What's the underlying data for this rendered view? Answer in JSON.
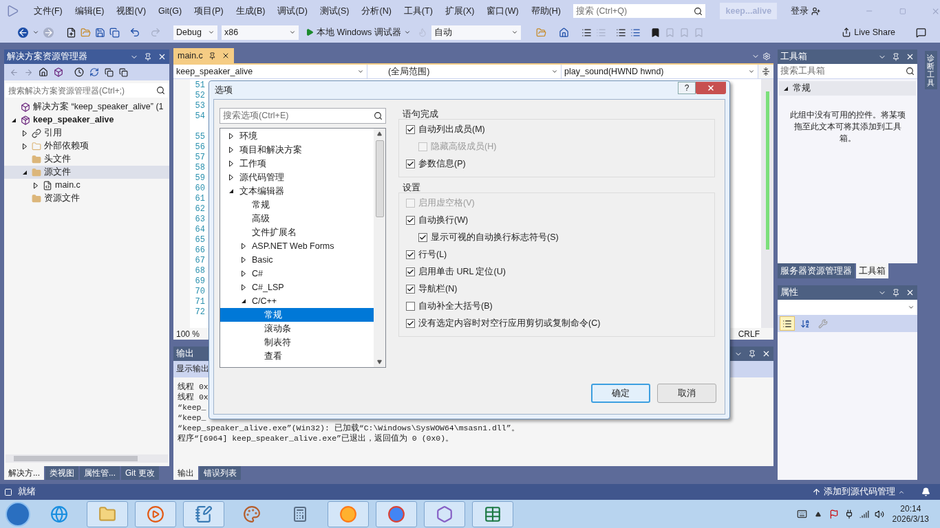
{
  "menu": {
    "items": [
      "文件(F)",
      "编辑(E)",
      "视图(V)",
      "Git(G)",
      "项目(P)",
      "生成(B)",
      "调试(D)",
      "测试(S)",
      "分析(N)",
      "工具(T)",
      "扩展(X)",
      "窗口(W)",
      "帮助(H)"
    ],
    "search_placeholder": "搜索 (Ctrl+Q)",
    "solution_badge": "keep...alive",
    "sign_in": "登录"
  },
  "toolbar": {
    "configuration": "Debug",
    "platform": "x86",
    "run_label": "本地 Windows 调试器",
    "target": "自动",
    "live_share": "Live Share"
  },
  "solution_explorer": {
    "title": "解决方案资源管理器",
    "search_placeholder": "搜索解决方案资源管理器(Ctrl+;)",
    "tree": [
      {
        "label": "解决方案 “keep_speaker_alive” (1",
        "kind": "solution",
        "selected": false
      },
      {
        "label": "keep_speaker_alive",
        "kind": "project",
        "expanded": true,
        "selected": false,
        "children": [
          {
            "label": "引用",
            "kind": "references",
            "expanded": false,
            "selected": false
          },
          {
            "label": "外部依赖项",
            "kind": "external",
            "expanded": false,
            "selected": false
          },
          {
            "label": "头文件",
            "kind": "filter",
            "selected": false
          },
          {
            "label": "源文件",
            "kind": "filter",
            "expanded": true,
            "selected": true,
            "children": [
              {
                "label": "main.c",
                "kind": "file",
                "expanded": false,
                "selected": false
              }
            ]
          },
          {
            "label": "资源文件",
            "kind": "filter",
            "selected": false
          }
        ]
      }
    ],
    "tabs": [
      {
        "label": "解决方...",
        "selected": true
      },
      {
        "label": "类视图",
        "selected": false
      },
      {
        "label": "属性管...",
        "selected": false
      },
      {
        "label": "Git 更改",
        "selected": false
      }
    ]
  },
  "editor": {
    "tabs": [
      {
        "label": "main.c",
        "selected": true
      }
    ],
    "nav": [
      "keep_speaker_alive",
      "(全局范围)",
      "play_sound(HWND hwnd)"
    ],
    "lines": [
      {
        "n": "51",
        "wrapped": false
      },
      {
        "n": "52",
        "wrapped": false
      },
      {
        "n": "53",
        "wrapped": false
      },
      {
        "n": "54",
        "wrapped": true
      },
      {
        "n": "55",
        "wrapped": false
      },
      {
        "n": "56",
        "wrapped": false
      },
      {
        "n": "57",
        "wrapped": false
      },
      {
        "n": "58",
        "wrapped": false
      },
      {
        "n": "59",
        "wrapped": false
      },
      {
        "n": "60",
        "wrapped": false
      },
      {
        "n": "61",
        "wrapped": false
      },
      {
        "n": "62",
        "wrapped": false
      },
      {
        "n": "63",
        "wrapped": false
      },
      {
        "n": "64",
        "wrapped": false
      },
      {
        "n": "65",
        "wrapped": false
      },
      {
        "n": "66",
        "wrapped": false
      },
      {
        "n": "67",
        "wrapped": false
      },
      {
        "n": "68",
        "wrapped": false
      },
      {
        "n": "69",
        "wrapped": false
      },
      {
        "n": "70",
        "wrapped": false
      },
      {
        "n": "71",
        "wrapped": false
      },
      {
        "n": "72",
        "wrapped": false
      }
    ],
    "zoom": "100 %",
    "line_ending": "CRLF"
  },
  "output": {
    "title": "输出",
    "source_label": "显示输出",
    "lines": [
      "线程 0x",
      "线程 0x",
      "“keep_",
      "“keep_",
      "“keep_speaker_alive.exe”(Win32): 已加载“C:\\Windows\\SysWOW64\\msasn1.dll”。",
      "程序“[6964] keep_speaker_alive.exe”已退出，返回值为 0 (0x0)。"
    ],
    "tabs": [
      {
        "label": "输出",
        "selected": true
      },
      {
        "label": "错误列表",
        "selected": false
      }
    ]
  },
  "toolbox": {
    "title": "工具箱",
    "search_placeholder": "搜索工具箱",
    "group": {
      "label": "常规",
      "expanded": true
    },
    "empty_message": "此组中没有可用的控件。将某项拖至此文本可将其添加到工具箱。",
    "tabs": [
      {
        "label": "服务器资源管理器",
        "selected": false
      },
      {
        "label": "工具箱",
        "selected": true
      }
    ]
  },
  "properties": {
    "title": "属性",
    "tools": [
      {
        "kind": "categorized",
        "selected": true
      },
      {
        "kind": "alphabetical",
        "selected": false
      },
      {
        "kind": "pages",
        "selected": false
      }
    ]
  },
  "side_tab": "诊断工具",
  "dialog": {
    "title": "选项",
    "help_label": "?",
    "search_placeholder": "搜索选项(Ctrl+E)",
    "tree": [
      {
        "label": "环境",
        "expanded": false,
        "selected": false
      },
      {
        "label": "项目和解决方案",
        "expanded": false,
        "selected": false
      },
      {
        "label": "工作项",
        "expanded": false,
        "selected": false
      },
      {
        "label": "源代码管理",
        "expanded": false,
        "selected": false
      },
      {
        "label": "文本编辑器",
        "expanded": true,
        "selected": false,
        "children": [
          {
            "label": "常规",
            "selected": false
          },
          {
            "label": "高级",
            "selected": false
          },
          {
            "label": "文件扩展名",
            "selected": false
          },
          {
            "label": "ASP.NET Web Forms",
            "expanded": false,
            "selected": false
          },
          {
            "label": "Basic",
            "expanded": false,
            "selected": false
          },
          {
            "label": "C#",
            "expanded": false,
            "selected": false
          },
          {
            "label": "C#_LSP",
            "expanded": false,
            "selected": false
          },
          {
            "label": "C/C++",
            "expanded": true,
            "selected": false,
            "children": [
              {
                "label": "常规",
                "selected": true
              },
              {
                "label": "滚动条",
                "selected": false
              },
              {
                "label": "制表符",
                "selected": false
              },
              {
                "label": "查看",
                "selected": false
              }
            ]
          }
        ]
      }
    ],
    "groups": [
      {
        "title": "语句完成",
        "options": [
          {
            "label": "自动列出成员(M)",
            "checked": true,
            "disabled": false,
            "children": [
              {
                "label": "隐藏高级成员(H)",
                "checked": false,
                "disabled": true
              }
            ]
          },
          {
            "label": "参数信息(P)",
            "checked": true,
            "disabled": false
          }
        ]
      },
      {
        "title": "设置",
        "options": [
          {
            "label": "启用虚空格(V)",
            "checked": false,
            "disabled": true
          },
          {
            "label": "自动换行(W)",
            "checked": true,
            "disabled": false,
            "children": [
              {
                "label": "显示可视的自动换行标志符号(S)",
                "checked": true,
                "disabled": false
              }
            ]
          },
          {
            "label": "行号(L)",
            "checked": true,
            "disabled": false
          },
          {
            "label": "启用单击 URL 定位(U)",
            "checked": true,
            "disabled": false
          },
          {
            "label": "导航栏(N)",
            "checked": true,
            "disabled": false
          },
          {
            "label": "自动补全大括号(B)",
            "checked": false,
            "disabled": false
          },
          {
            "label": "没有选定内容时对空行应用剪切或复制命令(C)",
            "checked": true,
            "disabled": false
          }
        ]
      }
    ],
    "buttons": [
      {
        "label": "确定",
        "default": true
      },
      {
        "label": "取消",
        "default": false
      }
    ]
  },
  "status_bar": {
    "text": "就绪",
    "source_control": "添加到源代码管理"
  },
  "taskbar": {
    "apps": [
      {
        "kind": "browser-e",
        "running": false
      },
      {
        "kind": "folder",
        "running": true
      },
      {
        "kind": "media",
        "running": true
      },
      {
        "kind": "notepad",
        "running": true
      },
      {
        "kind": "paint",
        "running": false
      },
      {
        "kind": "calculator",
        "running": false
      },
      {
        "kind": "fox",
        "running": true
      },
      {
        "kind": "chrome",
        "running": true
      },
      {
        "kind": "vs",
        "running": true
      },
      {
        "kind": "excel",
        "running": true
      }
    ],
    "time": "20:14",
    "date": "2026/3/13"
  }
}
